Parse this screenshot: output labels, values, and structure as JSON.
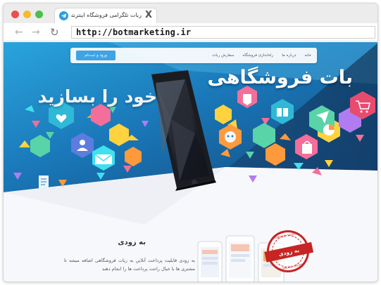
{
  "browser": {
    "tab_title": "ربات تلگرامی فروشگاه اینترنتی",
    "tab_close": "X",
    "url": "http://botmarketing.ir",
    "nav": {
      "back": "←",
      "forward": "→",
      "reload": "↻"
    }
  },
  "site": {
    "nav": {
      "button_label": "ورود و ثبت‌نام",
      "menu": [
        "خانه",
        "درباره ما",
        "راه‌اندازی فروشگاه",
        "سفارش ربات"
      ]
    },
    "hero": {
      "title": "بات فروشگاهی",
      "subtitle": "خود را بسازید"
    },
    "coming_soon": {
      "title": "به زودی",
      "description": "به زودی قابلیت پرداخت آنلاین به ربات فروشگاهی اضافه میشه تا مشتری ها با خیال راحت پرداخت ها را انجام دهند",
      "stamp_label": "به زودی",
      "stamp_ring_top": "COMING SOON",
      "stamp_ring_bottom": "COMING SOON"
    }
  },
  "colors": {
    "traffic_red": "#ed4c4c",
    "traffic_yellow": "#f2bc2c",
    "traffic_green": "#49c04a",
    "hero_blue": "#1f7fc4",
    "hero_dark": "#0e2a4a",
    "accent_button": "#3fa3e4",
    "stamp_red": "#c72424"
  },
  "icons": [
    "telegram-favicon-icon",
    "close-icon",
    "back-arrow-icon",
    "forward-arrow-icon",
    "reload-icon",
    "shopping-cart-icon",
    "paper-plane-icon",
    "shopping-bag-icon",
    "gift-icon",
    "pie-chart-icon",
    "user-icon",
    "robot-icon",
    "mail-icon",
    "document-icon",
    "heart-icon",
    "tag-icon",
    "smartphone-icon"
  ]
}
